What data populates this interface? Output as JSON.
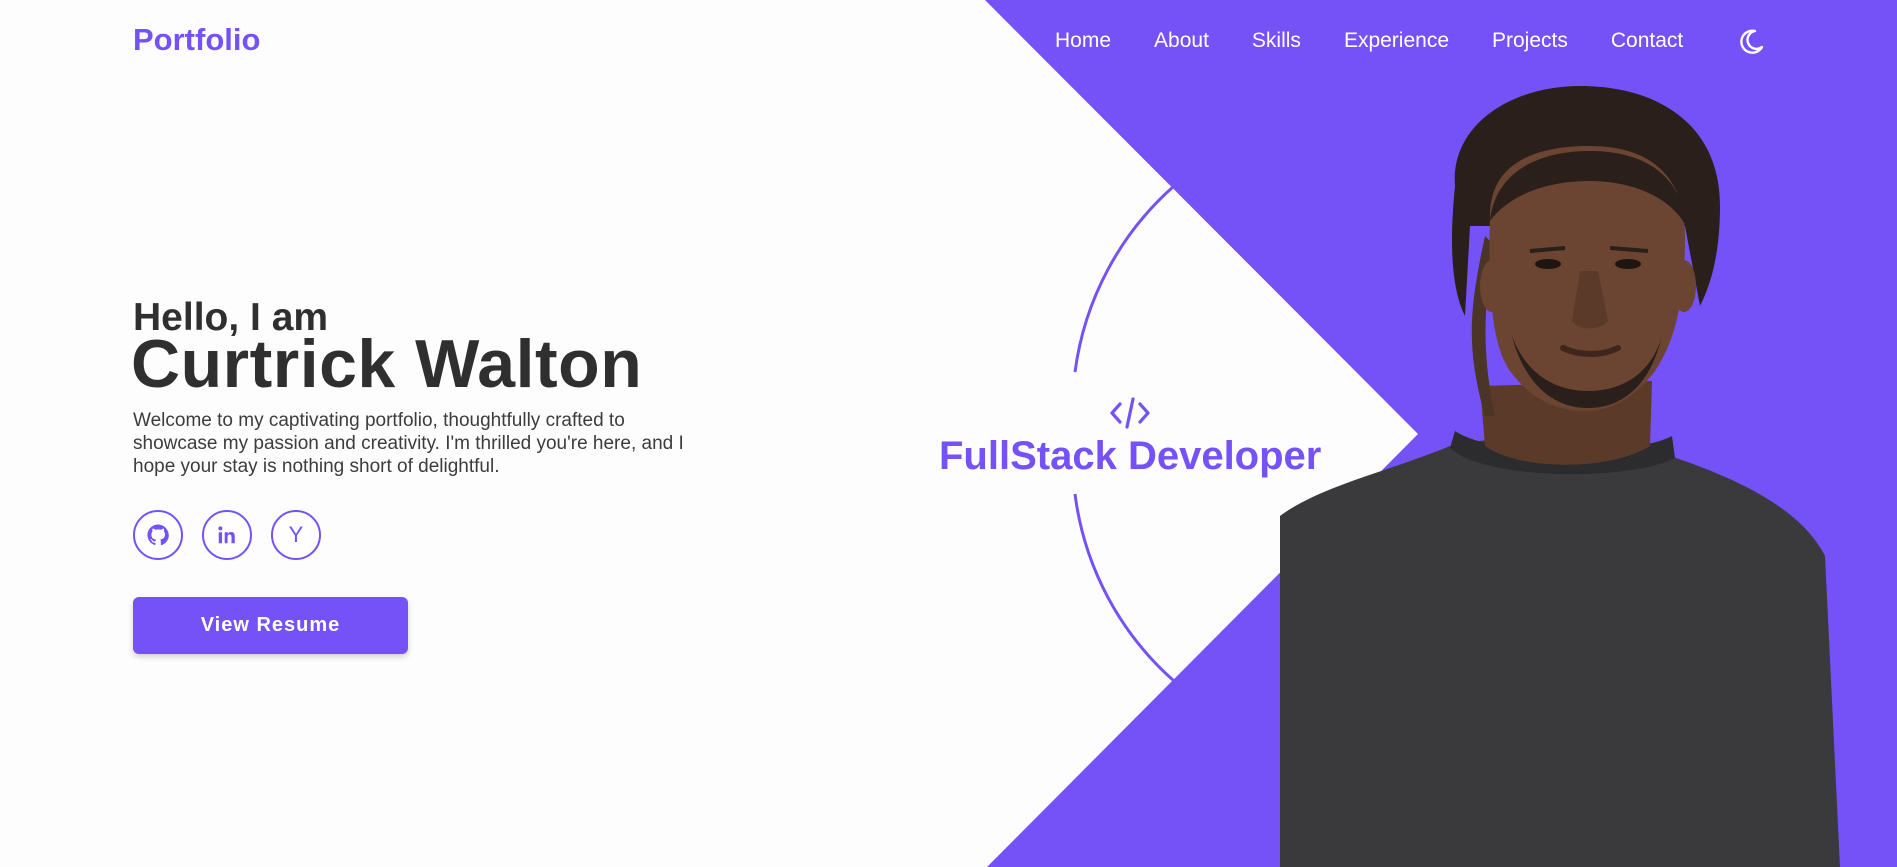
{
  "header": {
    "logo": "Portfolio",
    "nav": [
      "Home",
      "About",
      "Skills",
      "Experience",
      "Projects",
      "Contact"
    ],
    "theme_toggle_icon": "moon-icon"
  },
  "hero": {
    "greeting": "Hello, I am",
    "name": "Curtrick Walton",
    "intro": "Welcome to my captivating portfolio, thoughtfully crafted to showcase my passion and creativity. I'm thrilled you're here, and I hope your stay is nothing short of delightful.",
    "socials": [
      {
        "icon": "github-icon"
      },
      {
        "icon": "linkedin-icon",
        "label": "in"
      },
      {
        "icon": "ycombinator-icon",
        "label": "Y"
      }
    ],
    "resume_button": "View Resume",
    "role_icon": "code-icon",
    "role": "FullStack Developer"
  },
  "colors": {
    "accent": "#7552f8",
    "text_dark": "#2f2f2f",
    "background": "#fdfdfd"
  }
}
